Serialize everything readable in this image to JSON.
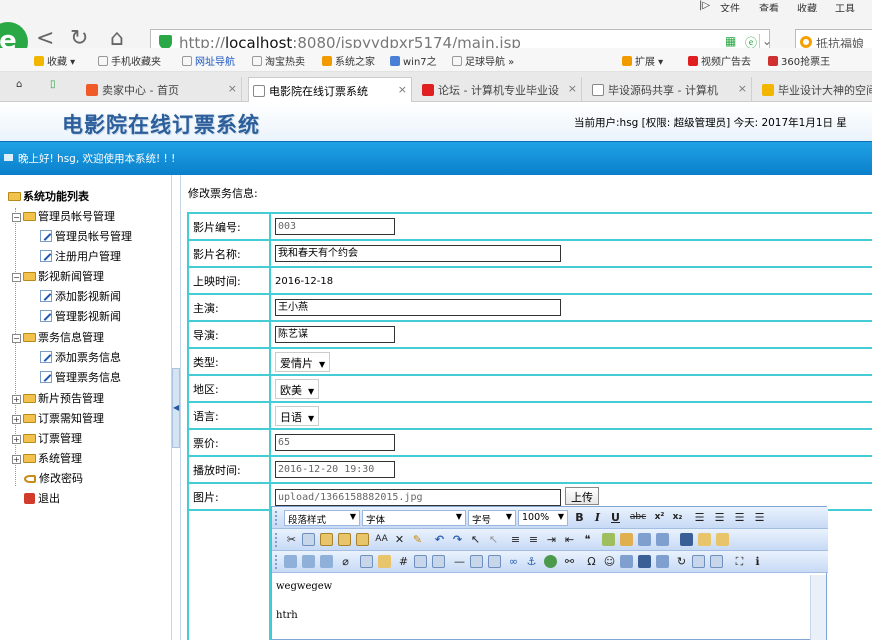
{
  "browser": {
    "menu": [
      "文件",
      "查看",
      "收藏",
      "工具"
    ],
    "url_prefix": "http://",
    "url_host": "localhost",
    "url_rest": ":8080/jspyydpxr5174/main.jsp",
    "search_placeholder": "抵抗福娘",
    "bookmarks": [
      "收藏",
      "手机收藏夹",
      "网址导航",
      "淘宝热卖",
      "系统之家",
      "win7之",
      "足球导航",
      "扩展",
      "视频广告去",
      "360抢票王"
    ],
    "tabs": [
      "卖家中心 - 首页",
      "电影院在线订票系统",
      "论坛 - 计算机专业毕业设",
      "毕设源码共享 - 计算机",
      "毕业设计大神的空间"
    ],
    "active_tab": 1
  },
  "app": {
    "title": "电影院在线订票系统",
    "user_info": "当前用户:hsg [权限: 超级管理员] 今天: 2017年1月1日 星",
    "welcome": "晚上好! hsg, 欢迎使用本系统! ! !"
  },
  "sidebar": {
    "root": "系统功能列表",
    "groups": [
      {
        "label": "管理员帐号管理",
        "children": [
          "管理员帐号管理",
          "注册用户管理"
        ]
      },
      {
        "label": "影视新闻管理",
        "children": [
          "添加影视新闻",
          "管理影视新闻"
        ]
      },
      {
        "label": "票务信息管理",
        "children": [
          "添加票务信息",
          "管理票务信息"
        ]
      },
      {
        "label": "新片预告管理",
        "children": []
      },
      {
        "label": "订票需知管理",
        "children": []
      },
      {
        "label": "订票管理",
        "children": []
      },
      {
        "label": "系统管理",
        "children": []
      }
    ],
    "change_password": "修改密码",
    "logout": "退出"
  },
  "form": {
    "heading": "修改票务信息:",
    "fields": {
      "film_no": {
        "label": "影片编号:",
        "value": "003"
      },
      "film_name": {
        "label": "影片名称:",
        "value": "我和春天有个约会"
      },
      "release_time": {
        "label": "上映时间:",
        "value": "2016-12-18"
      },
      "starring": {
        "label": "主演:",
        "value": "王小燕"
      },
      "director": {
        "label": "导演:",
        "value": "陈艺谋"
      },
      "type": {
        "label": "类型:",
        "value": "爱情片"
      },
      "region": {
        "label": "地区:",
        "value": "欧美"
      },
      "language": {
        "label": "语言:",
        "value": "日语"
      },
      "price": {
        "label": "票价:",
        "value": "65"
      },
      "show_time": {
        "label": "播放时间:",
        "value": "2016-12-20 19:30"
      },
      "picture": {
        "label": "图片:",
        "value": "upload/1366158882015.jpg",
        "button": "上传"
      }
    },
    "editor": {
      "paragraph_style": "段落样式",
      "font": "字体",
      "size": "字号",
      "zoom": "100%",
      "content": [
        "wegwegew",
        "htrh"
      ]
    }
  }
}
